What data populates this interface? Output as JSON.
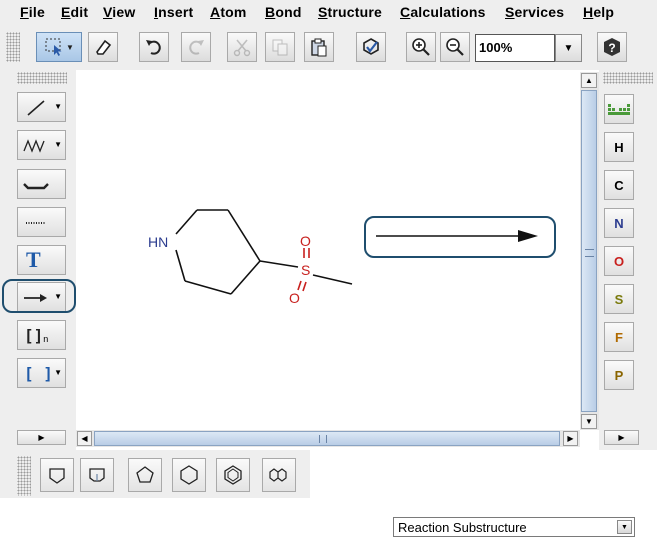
{
  "menu": {
    "file": "File",
    "edit": "Edit",
    "view": "View",
    "insert": "Insert",
    "atom": "Atom",
    "bond": "Bond",
    "structure": "Structure",
    "calculations": "Calculations",
    "services": "Services",
    "help": "Help"
  },
  "toolbar": {
    "zoom_value": "100%",
    "icons": [
      "selection-icon",
      "eraser-icon",
      "undo-icon",
      "redo-icon",
      "cut-icon",
      "copy-icon",
      "paste-icon",
      "check-structure-icon",
      "zoom-in-icon",
      "zoom-out-icon",
      "help-icon"
    ]
  },
  "left_tools": {
    "text_label": "T",
    "sgroup_label": "[]",
    "sgroup_sub": "n",
    "bracket_label": "[ ]"
  },
  "elements": {
    "h": "H",
    "c": "C",
    "n": "N",
    "o": "O",
    "s": "S",
    "f": "F",
    "p": "P",
    "colors": {
      "h": "#000000",
      "c": "#000000",
      "n": "#2b3c8f",
      "o": "#c8201e",
      "s": "#7a7a0c",
      "f": "#b06a00",
      "p": "#8a6500"
    }
  },
  "molecule": {
    "nh_label": "HN",
    "s_label": "S",
    "o_top": "O",
    "o_bottom": "O",
    "nh_color": "#2b3c8f",
    "s_color": "#c8201e",
    "o_color": "#c8201e"
  },
  "rings": [
    "cyclopropane-icon",
    "cyclobutane-icon",
    "cyclopentane-icon",
    "cyclohexane-icon",
    "benzene-icon",
    "naphthalene-icon"
  ],
  "mode_select": {
    "value": "Reaction Substructure"
  }
}
